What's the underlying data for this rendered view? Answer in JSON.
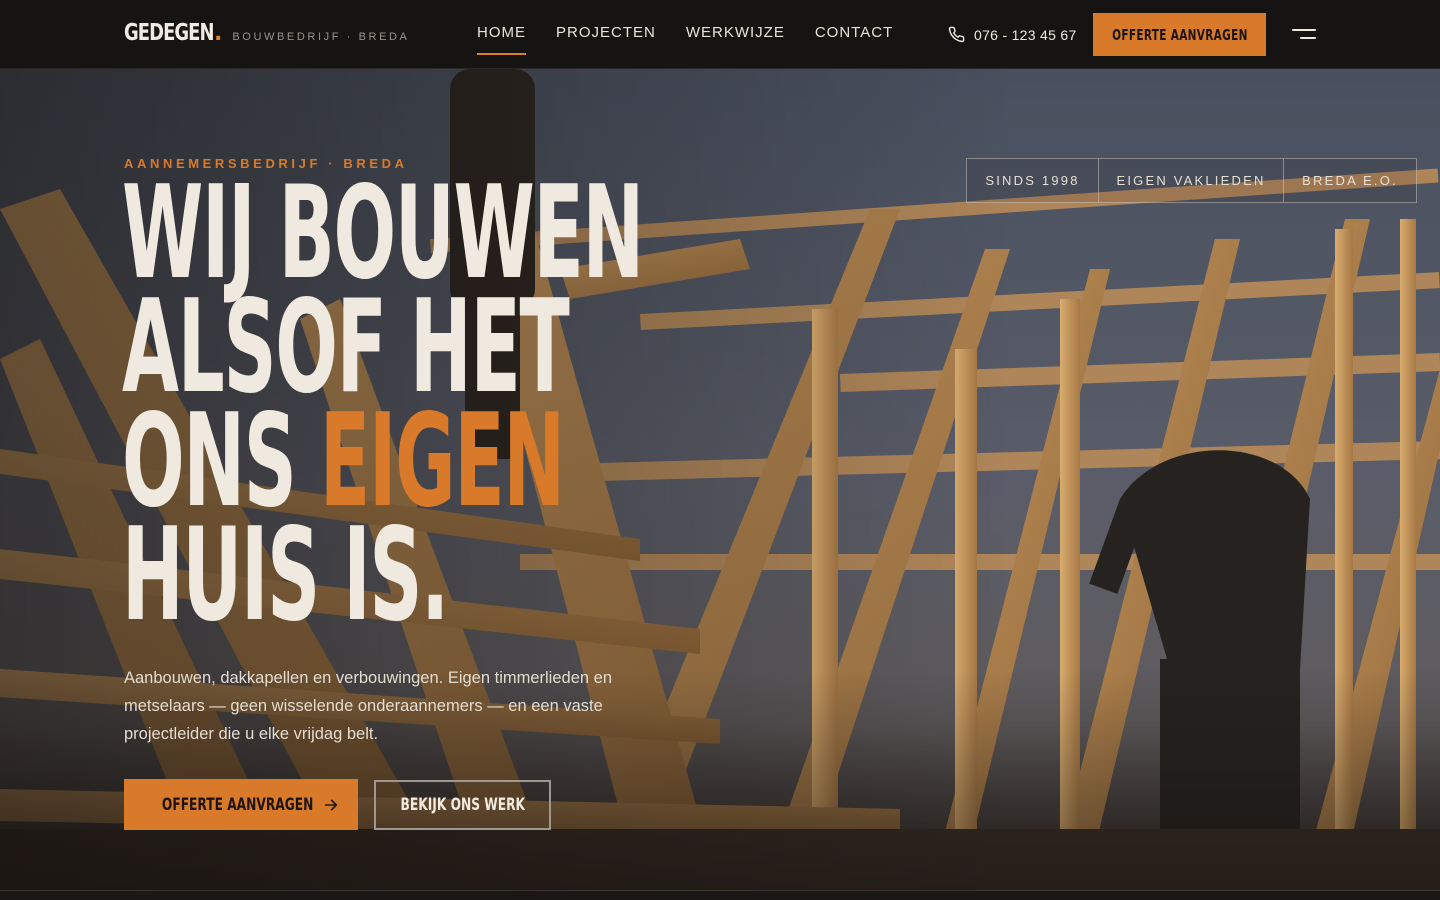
{
  "brand": {
    "name": "GEDEGEN",
    "dot": ".",
    "subtitle": "BOUWBEDRIJF · BREDA"
  },
  "nav": {
    "items": [
      {
        "label": "HOME",
        "active": true
      },
      {
        "label": "PROJECTEN",
        "active": false
      },
      {
        "label": "WERKWIJZE",
        "active": false
      },
      {
        "label": "CONTACT",
        "active": false
      }
    ]
  },
  "header": {
    "phone_icon": "phone-icon",
    "phone": "076 - 123 45 67",
    "cta_label": "OFFERTE AANVRAGEN",
    "menu_icon": "menu-icon"
  },
  "hero": {
    "eyebrow": "AANNEMERSBEDRIJF · BREDA",
    "headline": {
      "line1": "WIJ BOUWEN",
      "line2": "ALSOF HET",
      "line3_pre": "ONS ",
      "line3_accent": "EIGEN",
      "line4": "HUIS IS."
    },
    "lead": "Aanbouwen, dakkapellen en verbouwingen. Eigen timmerlieden en metselaars — geen wisselende onderaannemers — en een vaste projectleider die u elke vrijdag belt.",
    "primary_button": "OFFERTE AANVRAGEN",
    "primary_icon": "arrow-right-icon",
    "secondary_button": "BEKIJK ONS WERK",
    "badges": [
      "SINDS 1998",
      "EIGEN VAKLIEDEN",
      "BREDA E.O."
    ]
  },
  "colors": {
    "accent": "#d97a2b",
    "dark": "#161413",
    "text": "#efe9df"
  }
}
